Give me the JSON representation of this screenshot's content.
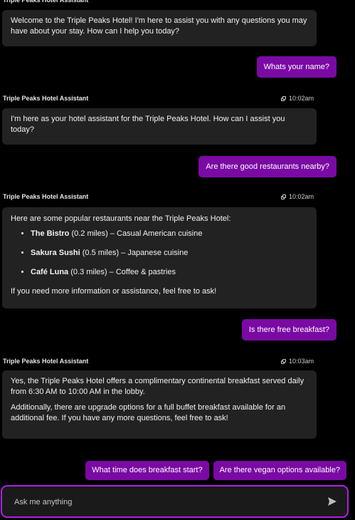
{
  "assistant_name": "Triple Peaks Hotel Assistant",
  "messages": [
    {
      "role": "assistant",
      "text": "Welcome to the Triple Peaks Hotel! I'm here to assist you with any questions you may have about your stay. How can I help you today?"
    },
    {
      "role": "user",
      "text": "Whats your name?"
    },
    {
      "role": "assistant",
      "time": "10:02am",
      "text": "I'm here as your hotel assistant for the Triple Peaks Hotel. How can I assist you today?"
    },
    {
      "role": "user",
      "text": "Are there good restaurants nearby?"
    },
    {
      "role": "assistant",
      "time": "10:02am",
      "intro": "Here are some popular restaurants near the Triple Peaks Hotel:",
      "items": [
        {
          "name": "The Bistro",
          "detail": " (0.2 miles) – Casual American cuisine"
        },
        {
          "name": "Sakura Sushi",
          "detail": " (0.5 miles) – Japanese cuisine"
        },
        {
          "name": "Café Luna",
          "detail": " (0.3 miles) – Coffee & pastries"
        }
      ],
      "outro": "If you need more information or assistance, feel free to ask!"
    },
    {
      "role": "user",
      "text": "Is there free breakfast?"
    },
    {
      "role": "assistant",
      "time": "10:03am",
      "p1": "Yes, the Triple Peaks Hotel offers a complimentary continental breakfast served daily from 6:30 AM to 10:00 AM in the lobby.",
      "p2": "Additionally, there are upgrade options for a full buffet breakfast available for an additional fee. If you have any more questions, feel free to ask!"
    }
  ],
  "suggestions": [
    "What time does breakfast start?",
    "Are there vegan options available?"
  ],
  "composer": {
    "placeholder": "Ask me anything"
  },
  "colors": {
    "accent": "#7a0aa3",
    "border": "#b01ee6",
    "bubble": "#222222",
    "background": "#000000"
  },
  "icons": {
    "copy": "copy-icon",
    "send": "send-icon"
  }
}
